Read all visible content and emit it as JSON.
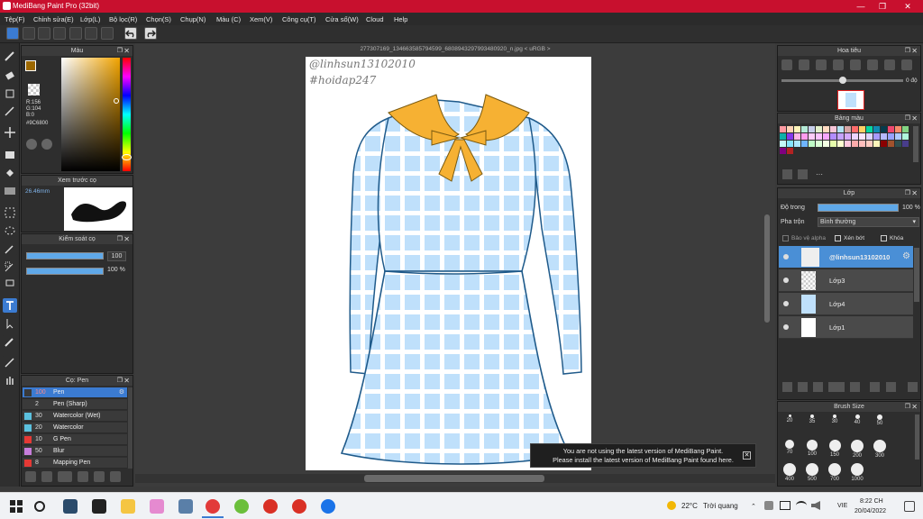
{
  "window": {
    "title": "MediBang Paint Pro (32bit)",
    "min": "—",
    "max": "❐",
    "close": "✕"
  },
  "menu": [
    "Tệp(F)",
    "Chỉnh sửa(E)",
    "Lớp(L)",
    "Bộ lọc(R)",
    "Chọn(S)",
    "Chụp(N)",
    "Màu (C)",
    "Xem(V)",
    "Công cụ(T)",
    "Cửa sổ(W)",
    "Cloud",
    "Help"
  ],
  "toolbar": {
    "undo_icon": "undo-icon",
    "redo_icon": "redo-icon"
  },
  "canvas": {
    "file_title": "277307169_134663585794599_6808943297993480920_n.jpg < uRGB >",
    "watermark1": "@linhsun13102010",
    "watermark2": "#hoidap247"
  },
  "notice": {
    "line1": "You are not using the latest version of MediBang Paint.",
    "line2": "Please install the latest version of MediBang Paint found here."
  },
  "color_panel": {
    "title": "Màu",
    "r": "R:156",
    "g": "G:104",
    "b": "B:0",
    "hex": "#9C6800",
    "fg_color": "#9c6800"
  },
  "brush_preview": {
    "title": "Xem trước cọ",
    "size": "26.46mm"
  },
  "brush_control": {
    "title": "Kiểm soát cọ",
    "size_value": "100",
    "opacity_value": "100 %"
  },
  "brushes": {
    "title": "Cọ: Pen",
    "items": [
      {
        "size": "100",
        "name": "Pen",
        "color": "#3a3a3a"
      },
      {
        "size": "2",
        "name": "Pen (Sharp)",
        "color": "#3a3a3a"
      },
      {
        "size": "30",
        "name": "Watercolor (Wet)",
        "color": "#5bc0de"
      },
      {
        "size": "20",
        "name": "Watercolor",
        "color": "#5bc0de"
      },
      {
        "size": "10",
        "name": "G Pen",
        "color": "#e53935"
      },
      {
        "size": "50",
        "name": "Blur",
        "color": "#c77ddb"
      },
      {
        "size": "8",
        "name": "Mapping Pen",
        "color": "#e53935"
      }
    ]
  },
  "navigator": {
    "title": "Hoa tiêu",
    "angle": "0 độ"
  },
  "swatches": {
    "title": "Bảng màu",
    "more": "···",
    "colors": [
      "#ff9aa2",
      "#ffd3b6",
      "#fff5ba",
      "#b5ead7",
      "#c7ceea",
      "#e2f0cb",
      "#ffdac1",
      "#f7c6d9",
      "#b2e2f2",
      "#d4a5a5",
      "#ff6b6b",
      "#ffd166",
      "#06d6a0",
      "#118ab2",
      "#073b4c",
      "#ef476f",
      "#f78c6b",
      "#83d483",
      "#0cb0a9",
      "#8338ec",
      "#ffb5e8",
      "#ff9cee",
      "#ffccf9",
      "#fcc2ff",
      "#f6a6ff",
      "#b28dff",
      "#c5a3ff",
      "#d5aaff",
      "#ecd4ff",
      "#fbe4ff",
      "#dcd3ff",
      "#a79aff",
      "#b5b9ff",
      "#97a2ff",
      "#afcbff",
      "#aff8db",
      "#c4faf8",
      "#85e3ff",
      "#ace7ff",
      "#6eb5ff",
      "#bffcc6",
      "#dbffd6",
      "#f3ffe3",
      "#e7ffac",
      "#ffffd1",
      "#ffc9de",
      "#ffabab",
      "#ffbebc",
      "#ffcbc1",
      "#fff5ba",
      "#8b0000",
      "#a0522d",
      "#2f4f4f",
      "#483d8b",
      "#800080",
      "#b22222"
    ]
  },
  "layers": {
    "title": "Lớp",
    "opacity_label": "Độ trong",
    "opacity_value": "100 %",
    "blend_label": "Pha trộn",
    "blend_value": "Bình thường",
    "alpha_label": "Bảo vệ alpha",
    "clip_label": "Xén bớt",
    "lock_label": "Khóa",
    "items": [
      {
        "name": "@linhsun13102010"
      },
      {
        "name": "Lớp3"
      },
      {
        "name": "Lớp4"
      },
      {
        "name": "Lớp1"
      }
    ]
  },
  "brush_size": {
    "title": "Brush Size",
    "rows": [
      [
        "20",
        "35",
        "30",
        "40",
        "50"
      ],
      [
        "70",
        "100",
        "150",
        "200",
        "300"
      ],
      [
        "400",
        "500",
        "700",
        "1000"
      ]
    ]
  },
  "taskbar": {
    "weather": "22°C",
    "weather_text": "Trời quang",
    "lang": "VIE",
    "time": "8:22 CH",
    "date": "20/04/2022"
  }
}
